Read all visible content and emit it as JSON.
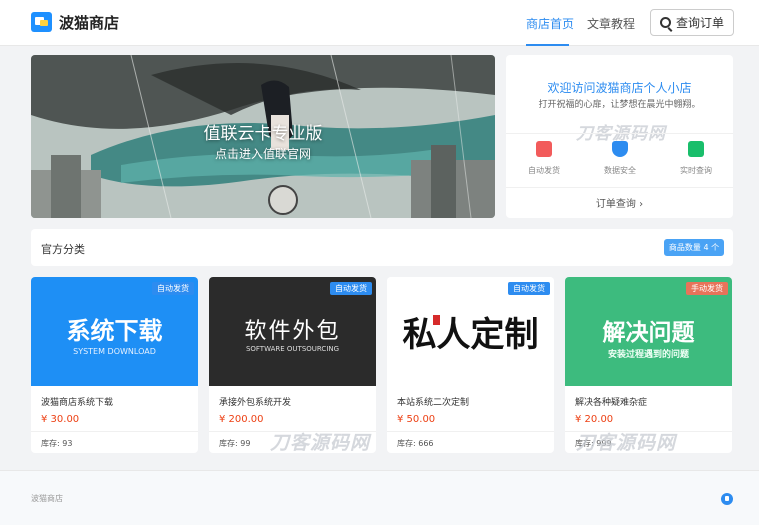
{
  "header": {
    "site_name": "波猫商店",
    "nav": [
      {
        "label": "商店首页",
        "active": true
      },
      {
        "label": "文章教程",
        "active": false
      }
    ],
    "query_button": "查询订单",
    "accent_color": "#2d8cf0"
  },
  "banner": {
    "title": "值联云卡专业版",
    "subtitle": "点击进入值联官网"
  },
  "welcome": {
    "title": "欢迎访问波猫商店个人小店",
    "subtitle": "打开祝福的心扉，让梦想在晨光中翱翔。",
    "features": [
      {
        "label": "自动发货",
        "icon": "truck-icon",
        "color": "#f25b5b"
      },
      {
        "label": "数据安全",
        "icon": "shield-icon",
        "color": "#2d8cf0"
      },
      {
        "label": "实时查询",
        "icon": "document-search-icon",
        "color": "#19be6b"
      }
    ],
    "order_link": "订单查询",
    "watermark": "刀客源码网"
  },
  "categories": {
    "title": "官方分类",
    "count_label": "商品数量 4 个"
  },
  "products": [
    {
      "image_title": "系统下载",
      "image_subtitle": "SYSTEM DOWNLOAD",
      "badge": "自动发货",
      "badge_color": "#2d8cf0",
      "bg_color": "#1e8ff5",
      "name": "波猫商店系统下载",
      "price": "¥ 30.00",
      "stock": "库存: 93"
    },
    {
      "image_title": "软件外包",
      "image_subtitle": "SOFTWARE OUTSOURCING",
      "badge": "自动发货",
      "badge_color": "#2d8cf0",
      "bg_color": "#2b2b2b",
      "name": "承接外包系统开发",
      "price": "¥ 200.00",
      "stock": "库存: 99"
    },
    {
      "image_title": "私人定制",
      "image_subtitle": "",
      "badge": "自动发货",
      "badge_color": "#2d8cf0",
      "bg_color": "#ffffff",
      "name": "本站系统二次定制",
      "price": "¥ 50.00",
      "stock": "库存: 666"
    },
    {
      "image_title": "解决问题",
      "image_subtitle": "安装过程遇到的问题",
      "badge": "手动发货",
      "badge_color": "#e8735a",
      "bg_color": "#3dbb7e",
      "name": "解决各种疑难杂症",
      "price": "¥ 20.00",
      "stock": "库存: 999"
    }
  ],
  "footer": {
    "text": "波猫商店",
    "icon": "shield-icon"
  }
}
